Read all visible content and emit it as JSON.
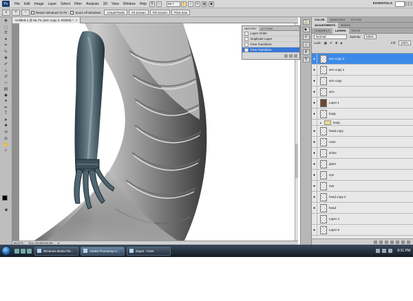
{
  "menubar": {
    "logo": "Ps",
    "items": [
      "File",
      "Edit",
      "Image",
      "Layer",
      "Select",
      "Filter",
      "Analysis",
      "3D",
      "View",
      "Window",
      "Help"
    ],
    "zoom": "66.7",
    "workspace": "ESSENTIALS"
  },
  "options": {
    "resize_label": "Resize Windows To Fit",
    "zoom_all_label": "Zoom All Windows",
    "actual_pixels": "Actual Pixels",
    "fit_screen": "Fit Screen",
    "fill_screen": "Fill Screen",
    "print_size": "Print Size"
  },
  "document": {
    "tab_title": "Untitled-1 @ 66.7% (arm copy 3, RGB/8) *",
    "status_zoom": "66.67%",
    "status_doc": "Doc: 24.0M/126.2M"
  },
  "history": {
    "tabs": [
      "HISTORY",
      "ACTIONS"
    ],
    "items": [
      "Layer Order",
      "Duplicate Layer",
      "Free Transform",
      "Free Transform"
    ],
    "active_index": 3
  },
  "panels": {
    "top_tabs": [
      "COLOR",
      "SWATCHES",
      "STYLES"
    ],
    "mid_tabs": [
      "ADJUSTMENTS",
      "MASKS"
    ],
    "layer_tabs": [
      "CHANNELS",
      "LAYERS",
      "PATHS"
    ],
    "blend_mode": "Normal",
    "opacity_label": "Opacity:",
    "opacity": "100%",
    "lock_label": "Lock:",
    "fill_label": "Fill:",
    "fill": "100%"
  },
  "layers": [
    {
      "name": "arm copy 3",
      "active": true,
      "visible": true,
      "thumb": "transparent"
    },
    {
      "name": "arm copy 2",
      "active": false,
      "visible": true,
      "thumb": "transparent"
    },
    {
      "name": "arm copy",
      "active": false,
      "visible": true,
      "thumb": "transparent"
    },
    {
      "name": "arm",
      "active": false,
      "visible": true,
      "thumb": "transparent"
    },
    {
      "name": "Layer 1",
      "active": false,
      "visible": true,
      "thumb": "photo"
    },
    {
      "name": "body",
      "active": false,
      "visible": true,
      "thumb": "transparent"
    },
    {
      "name": "body",
      "active": false,
      "visible": false,
      "thumb": "folder",
      "group": true
    },
    {
      "name": "head copy",
      "active": false,
      "visible": true,
      "thumb": "transparent"
    },
    {
      "name": "nose",
      "active": false,
      "visible": true,
      "thumb": "transparent"
    },
    {
      "name": "shine",
      "active": false,
      "visible": true,
      "thumb": "transparent"
    },
    {
      "name": "glare",
      "active": false,
      "visible": true,
      "thumb": "transparent"
    },
    {
      "name": "eye",
      "active": false,
      "visible": true,
      "thumb": "transparent"
    },
    {
      "name": "eye",
      "active": false,
      "visible": true,
      "thumb": "transparent"
    },
    {
      "name": "head copy 2",
      "active": false,
      "visible": true,
      "thumb": "transparent"
    },
    {
      "name": "head",
      "active": false,
      "visible": true,
      "thumb": "transparent"
    },
    {
      "name": "Layer 2",
      "active": false,
      "visible": false,
      "thumb": "transparent"
    },
    {
      "name": "Layer 6",
      "active": false,
      "visible": true,
      "thumb": "transparent"
    }
  ],
  "taskbar": {
    "tasks": [
      "Windows Media Pla...",
      "Adobe Photoshop C...",
      "dogs3 - Paint"
    ],
    "active_index": 1,
    "clock": "8:31 PM"
  },
  "colors": {
    "accent": "#3c8ae8",
    "history_active": "#3a76d6"
  }
}
